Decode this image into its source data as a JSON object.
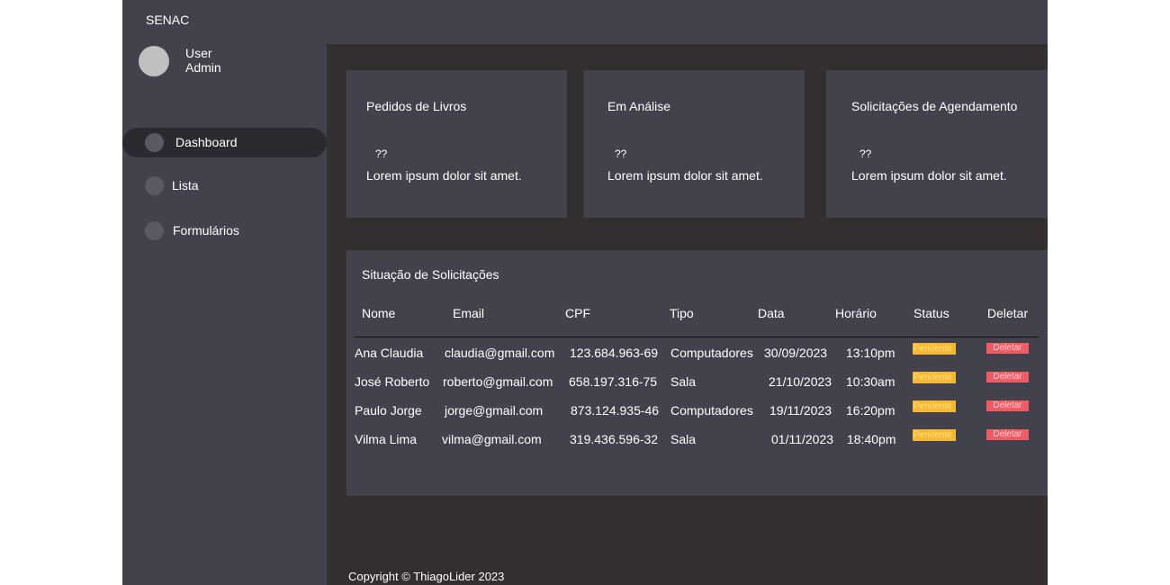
{
  "app": {
    "brand": "SENAC"
  },
  "user": {
    "line1": "User",
    "line2": "Admin"
  },
  "nav": [
    {
      "label": "Dashboard",
      "active": true
    },
    {
      "label": "Lista",
      "active": false
    },
    {
      "label": "Formulários",
      "active": false
    }
  ],
  "cards": [
    {
      "title": "Pedidos de Livros",
      "value": "??",
      "desc": "Lorem ipsum dolor sit amet."
    },
    {
      "title": "Em Análise",
      "value": "??",
      "desc": "Lorem ipsum dolor sit amet."
    },
    {
      "title": "Solicitações de Agendamento",
      "value": "??",
      "desc": "Lorem ipsum dolor sit amet."
    }
  ],
  "table": {
    "title": "Situação de Solicitações",
    "headers": [
      "Nome",
      "Email",
      "CPF",
      "Tipo",
      "Data",
      "Horário",
      "Status",
      "Deletar"
    ],
    "rows": [
      {
        "nome": "Ana Claudia",
        "email": "claudia@gmail.com",
        "cpf": "123.684.963-69",
        "tipo": "Computadores",
        "data": "30/09/2023",
        "horario": "13:10pm",
        "status": "Pendente",
        "action": "Deletar"
      },
      {
        "nome": "José Roberto",
        "email": "roberto@gmail.com",
        "cpf": "658.197.316-75",
        "tipo": "Sala",
        "data": "21/10/2023",
        "horario": "10:30am",
        "status": "Pendente",
        "action": "Deletar"
      },
      {
        "nome": "Paulo Jorge",
        "email": "jorge@gmail.com",
        "cpf": "873.124.935-46",
        "tipo": "Computadores",
        "data": "19/11/2023",
        "horario": "16:20pm",
        "status": "Pendente",
        "action": "Deletar"
      },
      {
        "nome": "Vilma Lima",
        "email": "vilma@gmail.com",
        "cpf": "319.436.596-32",
        "tipo": "Sala",
        "data": "01/11/2023",
        "horario": "18:40pm",
        "status": "Pendente",
        "action": "Deletar"
      }
    ]
  },
  "footer": {
    "text": "Copyright © ThiagoLider 2023"
  },
  "colors": {
    "sidebar": "#42424c",
    "main": "#332f2e",
    "pending": "#f5b82e",
    "delete": "#ef5b63"
  }
}
